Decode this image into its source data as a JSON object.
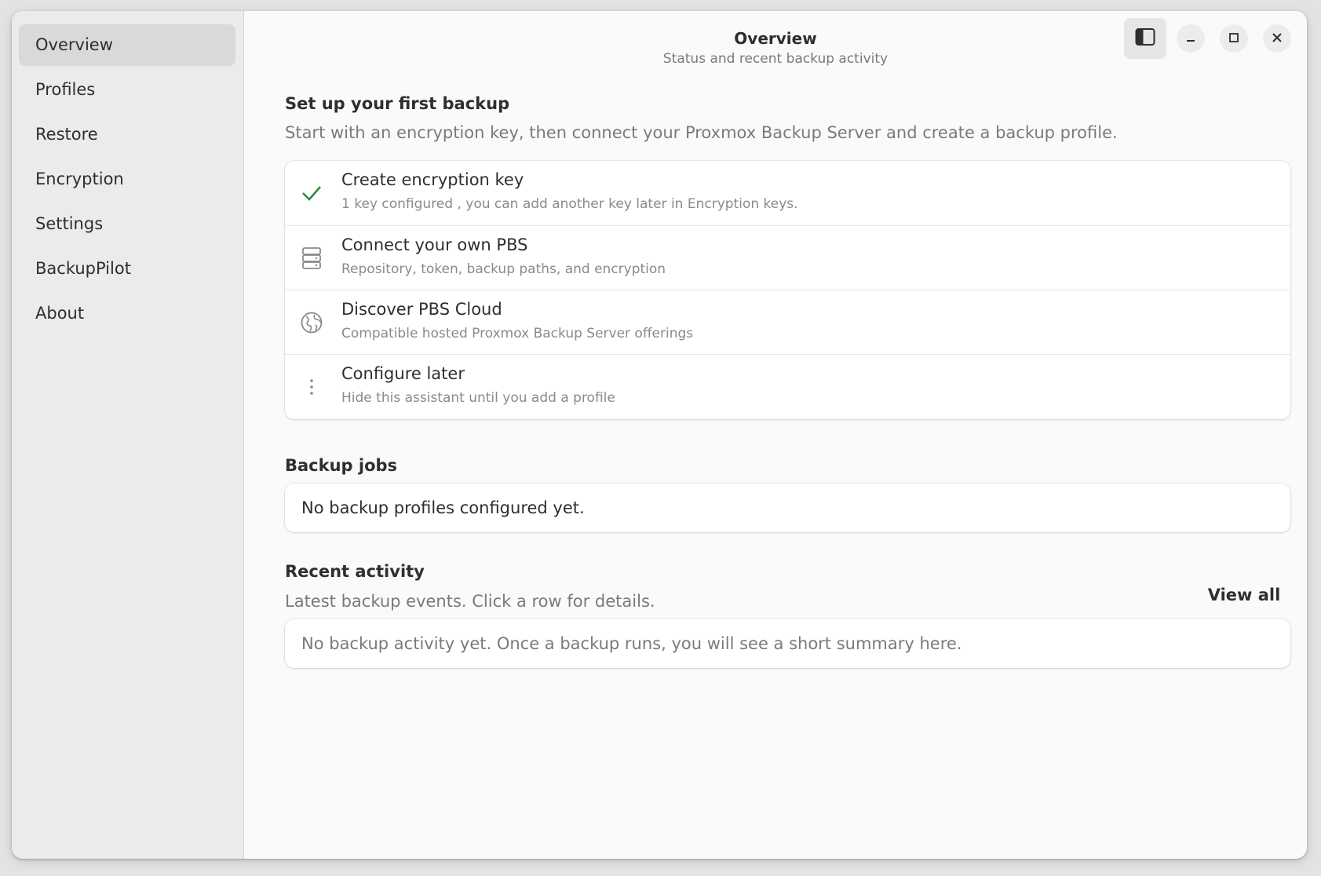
{
  "header": {
    "title": "Overview",
    "subtitle": "Status and recent backup activity"
  },
  "sidebar": {
    "items": [
      {
        "label": "Overview",
        "active": true
      },
      {
        "label": "Profiles"
      },
      {
        "label": "Restore"
      },
      {
        "label": "Encryption"
      },
      {
        "label": "Settings"
      },
      {
        "label": "BackupPilot"
      },
      {
        "label": "About"
      }
    ]
  },
  "window_controls": {
    "sidebar_toggle_icon": "sidebar-toggle-icon",
    "minimize_icon": "minimize-icon",
    "maximize_icon": "maximize-icon",
    "close_icon": "close-icon"
  },
  "setup": {
    "title": "Set up your first backup",
    "description": "Start with an encryption key, then connect your Proxmox Backup Server and create a backup profile.",
    "steps": [
      {
        "icon": "checkmark-icon",
        "title": "Create encryption key",
        "subtitle": "1 key configured , you can add another key later in Encryption keys.",
        "done": true
      },
      {
        "icon": "server-icon",
        "title": "Connect your own PBS",
        "subtitle": "Repository, token, backup paths, and encryption"
      },
      {
        "icon": "globe-icon",
        "title": "Discover PBS Cloud",
        "subtitle": "Compatible hosted Proxmox Backup Server offerings"
      },
      {
        "icon": "more-vertical-icon",
        "title": "Configure later",
        "subtitle": "Hide this assistant until you add a profile"
      }
    ]
  },
  "backup_jobs": {
    "title": "Backup jobs",
    "empty_text": "No backup profiles configured yet."
  },
  "recent_activity": {
    "title": "Recent activity",
    "description": "Latest backup events. Click a row for details.",
    "view_all_label": "View all",
    "empty_text": "No backup activity yet. Once a backup runs, you will see a short summary here."
  },
  "colors": {
    "success": "#2e8b3e",
    "sidebar_bg": "#ebebeb",
    "content_bg": "#fafafa"
  }
}
